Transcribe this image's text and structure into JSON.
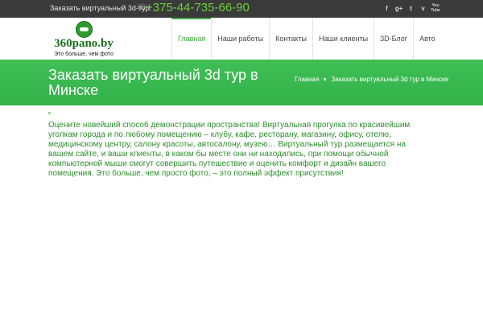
{
  "topbar": {
    "order_text": "Заказать виртуальный 3d-тур:",
    "phone": "+375-44-735-66-90",
    "social": [
      "f",
      "g+",
      "t",
      "v",
      "You Tube"
    ]
  },
  "logo": {
    "name": "360pano.by",
    "tagline": "Это больше, чем фото"
  },
  "nav": {
    "items": [
      "Главная",
      "Наши работы",
      "Контакты",
      "Наши клиенты",
      "3D-Блог",
      "Авто"
    ]
  },
  "band": {
    "title": "Заказать виртуальный 3d тур в Минске",
    "breadcrumb_home": "Главная",
    "breadcrumb_current": "Заказать виртуальный 3d тур в Минске"
  },
  "content": {
    "paragraph": "Оцените новейший способ демонстрации пространства! Виртуальная прогулка по красивейшим уголкам города и по любому помещению – клубу, кафе, ресторану, магазину, офису, отелю, медицинскому центру, салону красоты, автосалону, музею… Виртуальный тур размещается на вашем сайте, и ваши клиенты, в каком бы месте они ни находились, при помощи обычной компьютерной мыши смогут совершить путешествие и оценить комфорт и дизайн вашего помещения. Это больше, чем просто фото, – это полный эффект присутствия!"
  }
}
